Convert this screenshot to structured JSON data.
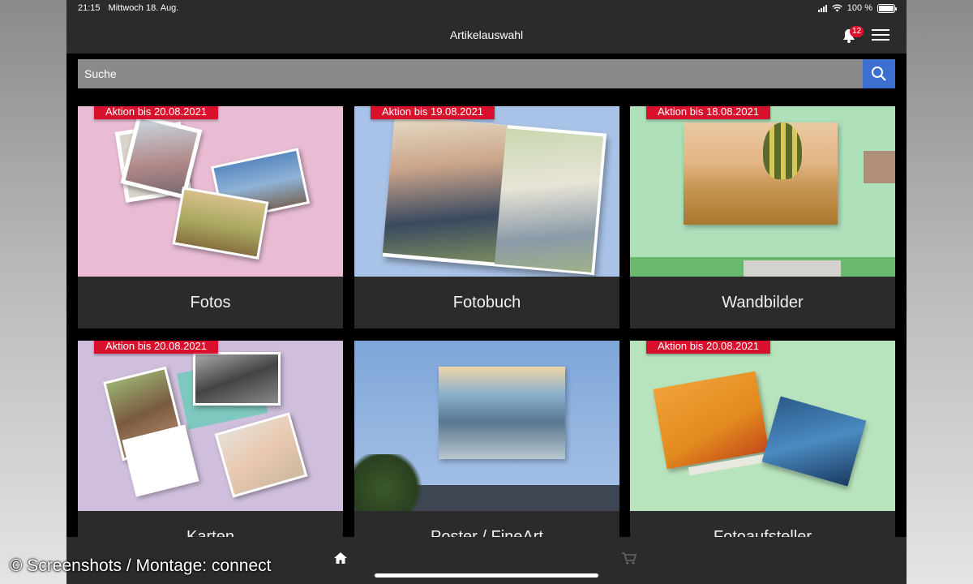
{
  "status": {
    "time": "21:15",
    "date": "Mittwoch 18. Aug.",
    "battery": "100 %"
  },
  "nav": {
    "title": "Artikelauswahl",
    "notifications": "12",
    "icons": [
      "bell-icon",
      "menu-icon"
    ]
  },
  "search": {
    "placeholder": "Suche",
    "icon": "search-icon"
  },
  "cards": [
    {
      "label": "Fotos",
      "promo": "Aktion bis 20.08.2021"
    },
    {
      "label": "Fotobuch",
      "promo": "Aktion bis 19.08.2021"
    },
    {
      "label": "Wandbilder",
      "promo": "Aktion bis 18.08.2021"
    },
    {
      "label": "Karten",
      "promo": "Aktion bis 20.08.2021"
    },
    {
      "label": "Poster / FineArt",
      "promo": ""
    },
    {
      "label": "Fotoaufsteller",
      "promo": "Aktion bis 20.08.2021"
    }
  ],
  "tabbar": {
    "icons": [
      "home-icon",
      "cart-icon"
    ]
  },
  "watermark": "© Screenshots / Montage: connect",
  "colors": {
    "promo": "#d8102c",
    "search_button": "#3d6fd1",
    "bar": "#2b2b2b"
  }
}
